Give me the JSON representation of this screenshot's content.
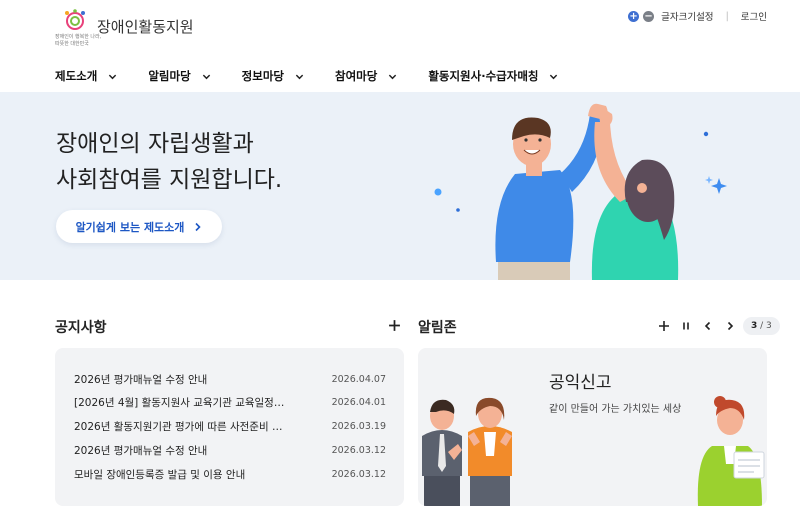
{
  "header": {
    "logo_text": "장애인활동지원",
    "logo_slogan_1": "장애인이 행복한 나라,",
    "logo_slogan_2": "따뜻한 대한민국",
    "font_size_label": "글자크기설정",
    "login_label": "로그인"
  },
  "nav": [
    {
      "label": "제도소개"
    },
    {
      "label": "알림마당"
    },
    {
      "label": "정보마당"
    },
    {
      "label": "참여마당"
    },
    {
      "label": "활동지원사·수급자매칭"
    }
  ],
  "hero": {
    "line1": "장애인의 자립생활과",
    "line2": "사회참여를 지원합니다.",
    "button_label": "알기쉽게 보는 제도소개"
  },
  "notice": {
    "title": "공지사항",
    "items": [
      {
        "title": "2026년 평가매뉴얼 수정 안내",
        "date": "2026.04.07"
      },
      {
        "title": "[2026년 4월] 활동지원사 교육기관 교육일정…",
        "date": "2026.04.01"
      },
      {
        "title": "2026년 활동지원기관 평가에 따른 사전준비 …",
        "date": "2026.03.19"
      },
      {
        "title": "2026년 평가매뉴얼 수정 안내",
        "date": "2026.03.12"
      },
      {
        "title": "모바일 장애인등록증 발급 및 이용 안내",
        "date": "2026.03.12"
      }
    ]
  },
  "alert_zone": {
    "title": "알림존",
    "current_page": "3",
    "total_pages": "3",
    "card_title": "공익신고",
    "card_desc": "같이 만들어 가는 가치있는 세상"
  },
  "colors": {
    "accent": "#1d57c4",
    "hero_bg": "#ebf1f8",
    "panel_bg": "#f2f3f5"
  }
}
